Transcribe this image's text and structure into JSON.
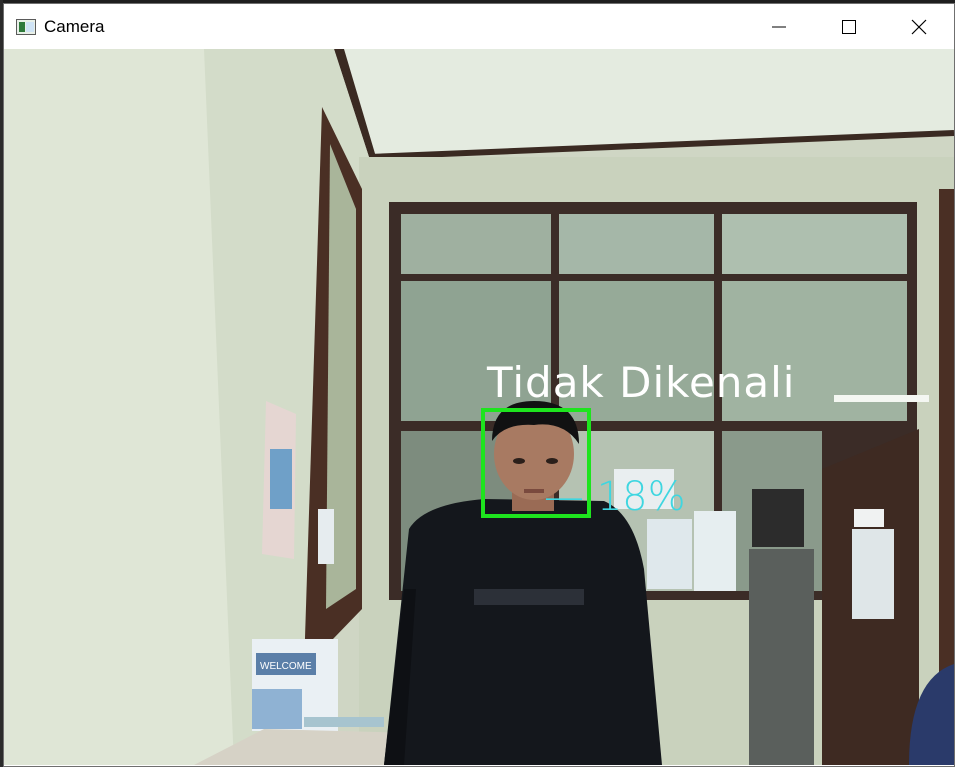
{
  "window": {
    "title": "Camera",
    "icon": "camera-window-icon",
    "controls": {
      "minimize": "minimize-icon",
      "maximize": "maximize-icon",
      "close": "close-icon"
    }
  },
  "detection": {
    "label": "Tidak Dikenali",
    "score": "— 18%",
    "box_color": "#1ee41e",
    "label_color": "#ffffff",
    "score_color": "#3fd6e0"
  },
  "scene": {
    "poster_text": "WELCOME"
  }
}
